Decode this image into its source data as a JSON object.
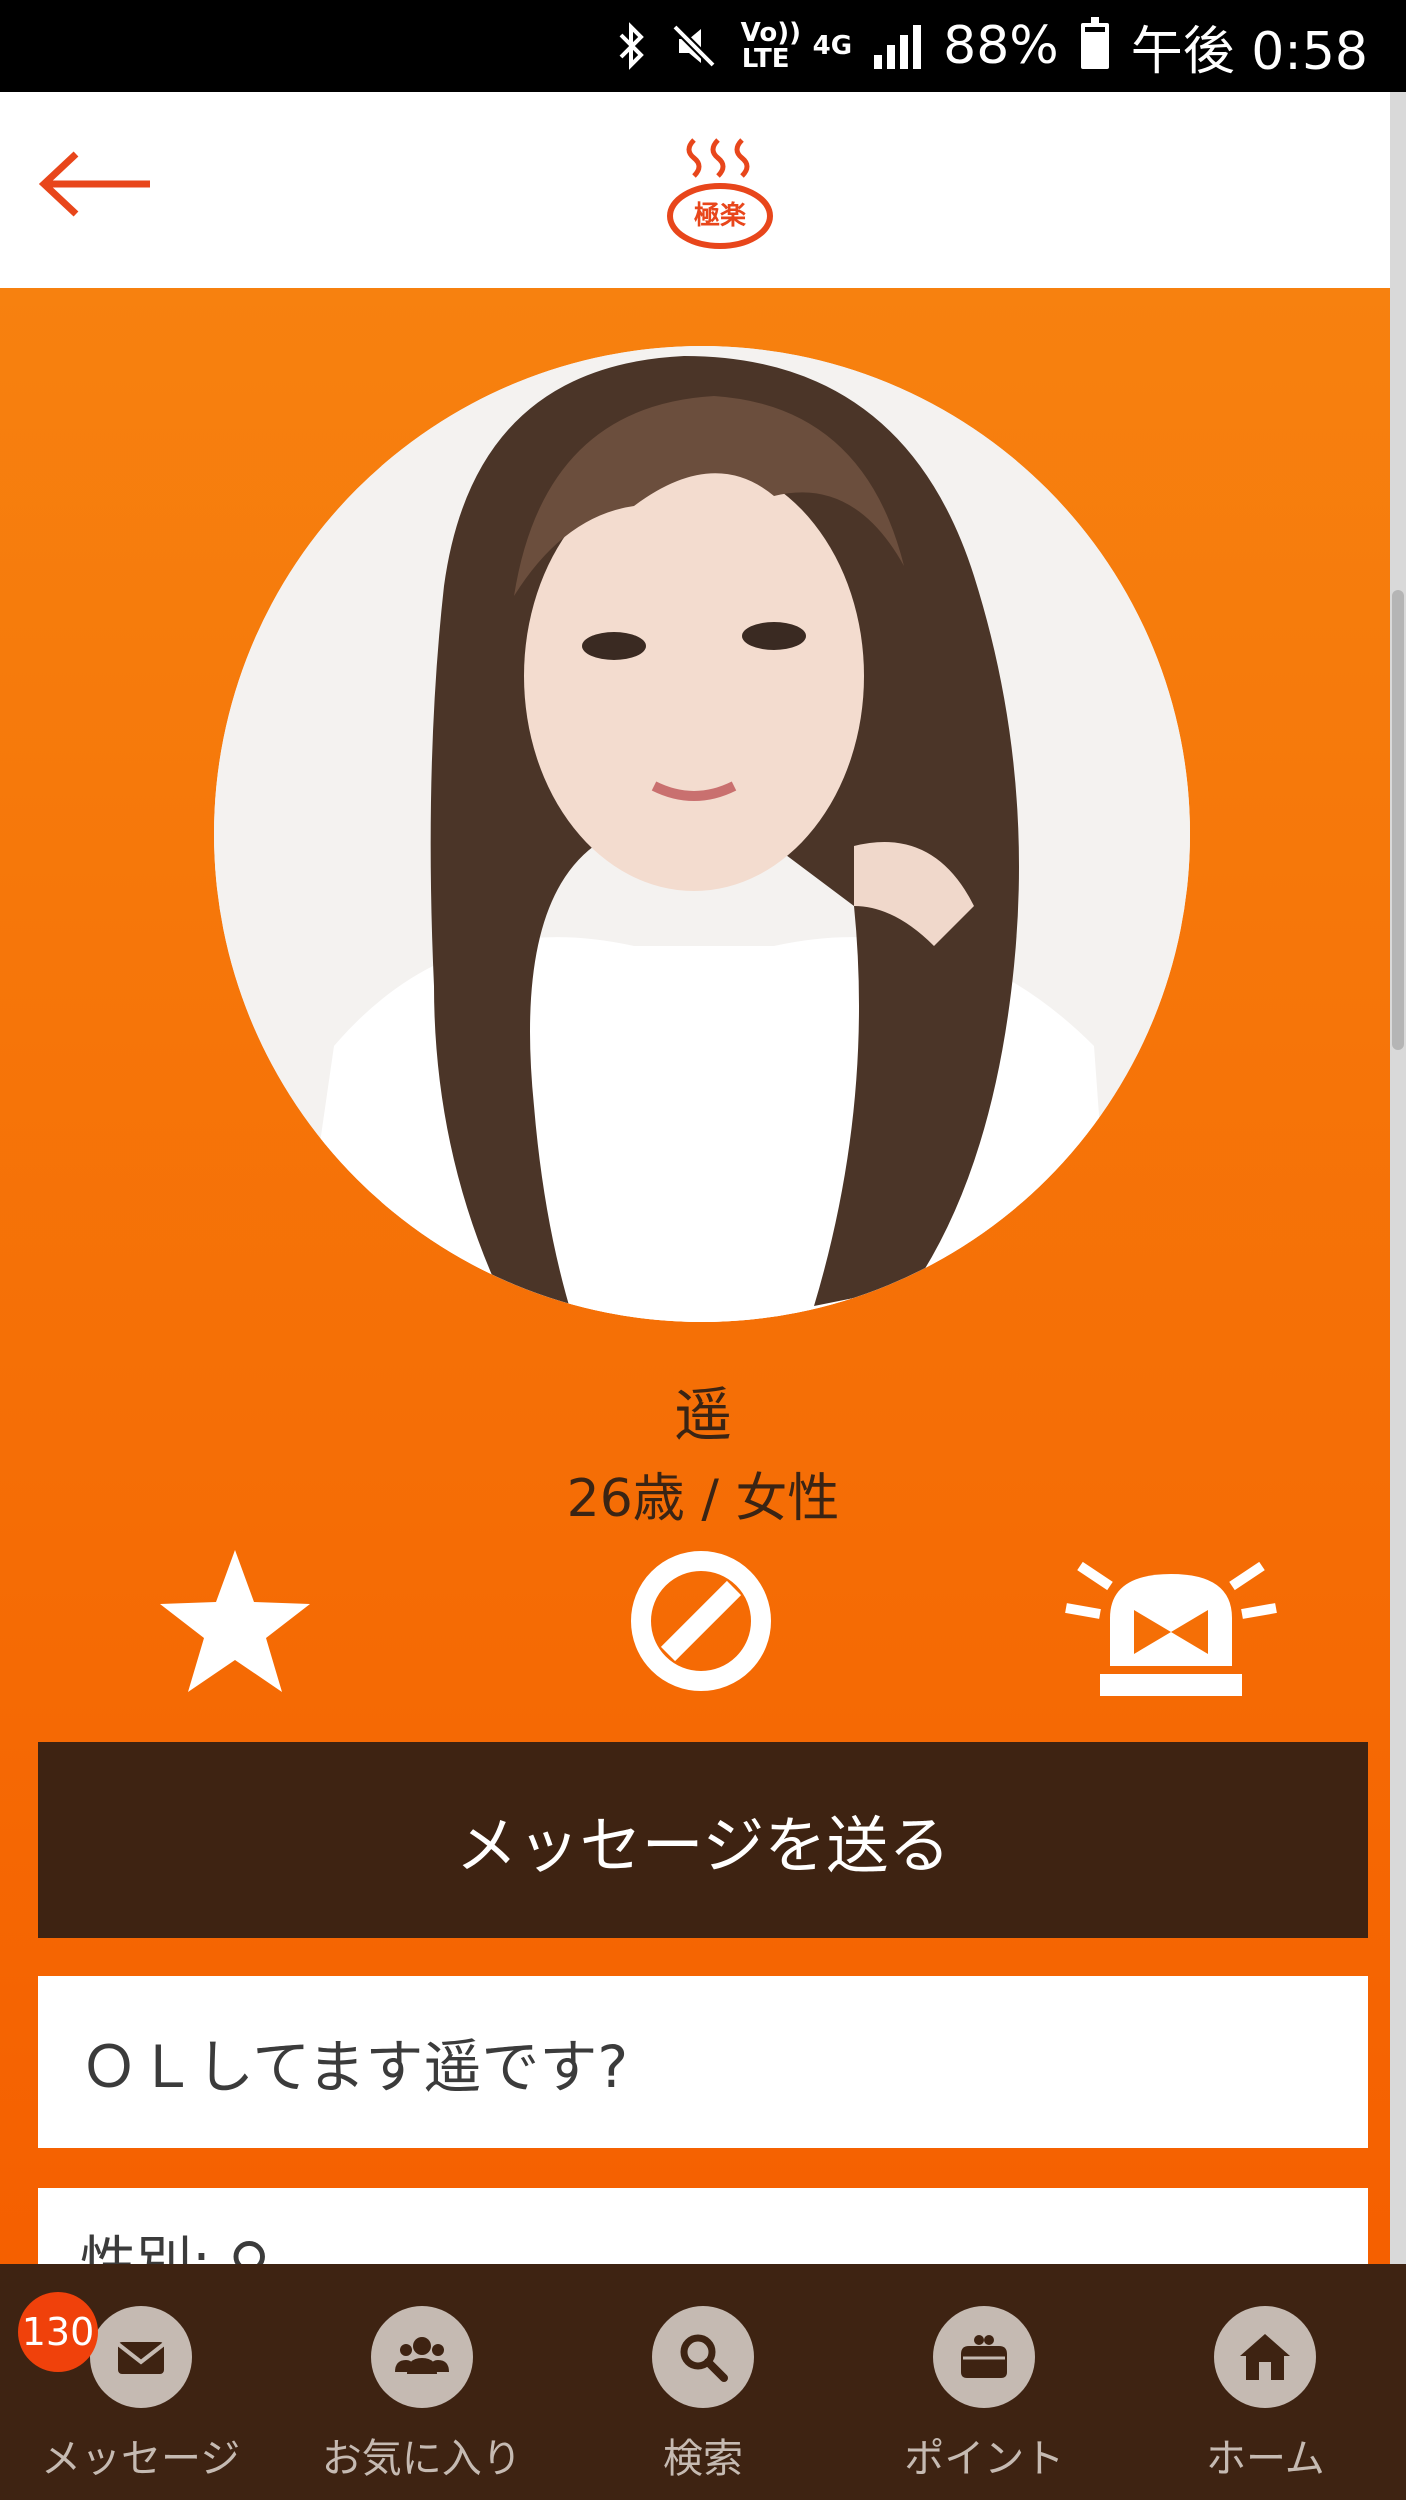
{
  "status_bar": {
    "volte": "Vo)) LTE",
    "network": "4G",
    "battery": "88%",
    "time": "午後 0:58"
  },
  "header": {
    "back_icon": "arrow-left-icon",
    "logo_text": "極楽",
    "accent_color": "#e8461b"
  },
  "profile": {
    "name": "遥",
    "age_gender": "26歳 / 女性",
    "actions": [
      "star-icon",
      "block-icon",
      "report-siren-icon"
    ],
    "send_message_label": "メッセージを送る",
    "bio": "ＯＬしてます遥です?",
    "detail_partial": "性別: ♀"
  },
  "bottom_nav": {
    "items": [
      {
        "label": "メッセージ",
        "icon": "envelope-icon",
        "badge": "130"
      },
      {
        "label": "お気に入り",
        "icon": "people-icon"
      },
      {
        "label": "検索",
        "icon": "search-icon"
      },
      {
        "label": "ポイント",
        "icon": "coin-purse-icon"
      },
      {
        "label": "ホーム",
        "icon": "home-icon"
      }
    ]
  },
  "colors": {
    "orange_top": "#f7810f",
    "orange_bottom": "#f55f00",
    "dark_brown": "#3e2312",
    "nav_gray": "#c5bab2"
  }
}
